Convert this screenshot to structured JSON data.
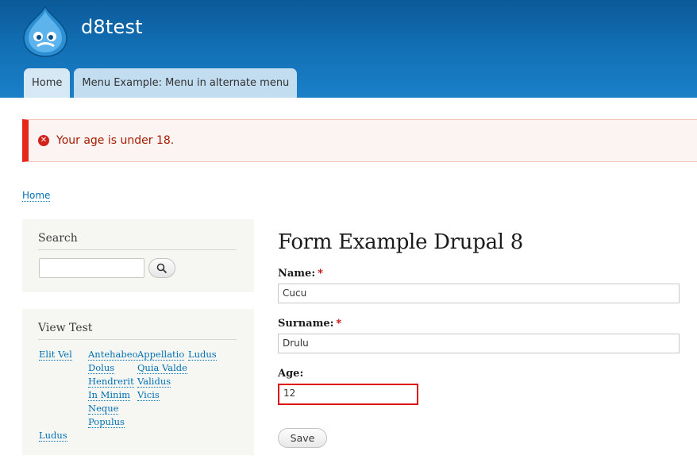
{
  "site": {
    "name": "d8test"
  },
  "tabs": [
    {
      "label": "Home"
    },
    {
      "label": "Menu Example: Menu in alternate menu"
    }
  ],
  "message": {
    "text": "Your age is under 18."
  },
  "breadcrumb": {
    "home": "Home"
  },
  "search_block": {
    "title": "Search",
    "input_value": ""
  },
  "view_block": {
    "title": "View Test",
    "links": [
      "Elit Vel",
      "Antehabeo",
      "Appellatio",
      "Ludus",
      "Dolus",
      "Quia Valde",
      "Hendrerit",
      "Validus",
      "In Minim",
      "Vicis",
      "Neque",
      "Populus",
      "Ludus"
    ]
  },
  "main": {
    "title": "Form Example Drupal 8",
    "name_label": "Name:",
    "name_value": "Cucu",
    "surname_label": "Surname:",
    "surname_value": "Drulu",
    "age_label": "Age:",
    "age_value": "12",
    "required_mark": "*",
    "save_label": "Save"
  },
  "colors": {
    "header": "#1372b8",
    "tab": "#c2dcf0",
    "error_border": "#e6281b",
    "error_text": "#a51b00",
    "link": "#0071b3"
  },
  "icons": {
    "logo": "drupal-drop-logo",
    "error": "error-x-icon",
    "search": "magnifier-icon"
  }
}
